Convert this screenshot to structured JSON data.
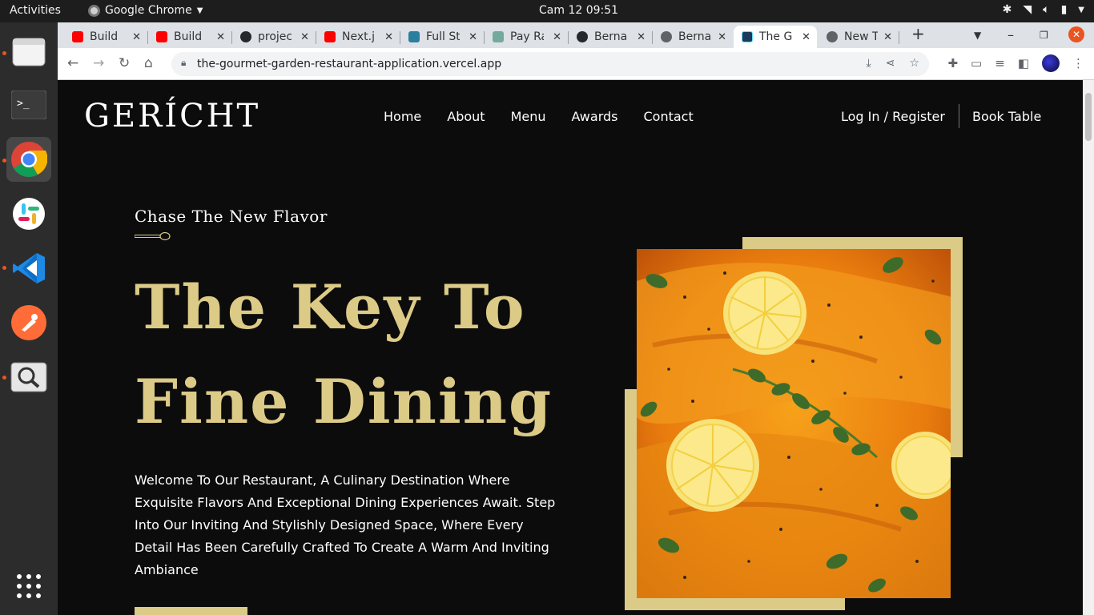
{
  "system": {
    "activities": "Activities",
    "app_name": "Google Chrome",
    "clock": "Cam 12  09:51"
  },
  "dock": {
    "items": [
      {
        "name": "Files",
        "icon": "files-icon"
      },
      {
        "name": "Terminal",
        "icon": "terminal-icon"
      },
      {
        "name": "Google Chrome",
        "icon": "chrome-icon"
      },
      {
        "name": "Slack",
        "icon": "slack-icon"
      },
      {
        "name": "Visual Studio Code",
        "icon": "vscode-icon"
      },
      {
        "name": "Postman",
        "icon": "postman-icon"
      },
      {
        "name": "Image Viewer",
        "icon": "magnifier-icon"
      }
    ]
  },
  "browser": {
    "tabs": [
      {
        "label": "Build",
        "icon": "youtube-icon"
      },
      {
        "label": "Build",
        "icon": "youtube-icon"
      },
      {
        "label": "projec",
        "icon": "github-icon"
      },
      {
        "label": "Next.j",
        "icon": "youtube-icon"
      },
      {
        "label": "Full St",
        "icon": "site-icon"
      },
      {
        "label": "Pay Ra",
        "icon": "chatgpt-icon"
      },
      {
        "label": "Berna",
        "icon": "github-icon"
      },
      {
        "label": "Berna",
        "icon": "globe-icon"
      },
      {
        "label": "The G",
        "icon": "react-icon",
        "active": true
      },
      {
        "label": "New T",
        "icon": "globe-icon"
      }
    ],
    "url": "the-gourmet-garden-restaurant-application.vercel.app"
  },
  "site": {
    "logo": "GERÍCHT",
    "nav": [
      "Home",
      "About",
      "Menu",
      "Awards",
      "Contact"
    ],
    "auth_link": "Log In / Register",
    "book_link": "Book Table",
    "hero": {
      "subtitle": "Chase The New Flavor",
      "headline_line1": "The Key To",
      "headline_line2": "Fine Dining",
      "body": "Welcome To Our Restaurant, A Culinary Destination Where Exquisite Flavors And Exceptional Dining Experiences Await. Step Into Our Inviting And Stylishly Designed Space, Where Every Detail Has Been Carefully Crafted To Create A Warm And Inviting Ambiance"
    }
  },
  "colors": {
    "gold": "#dcca87",
    "black": "#0c0c0c",
    "ubuntu_orange": "#e95420"
  }
}
